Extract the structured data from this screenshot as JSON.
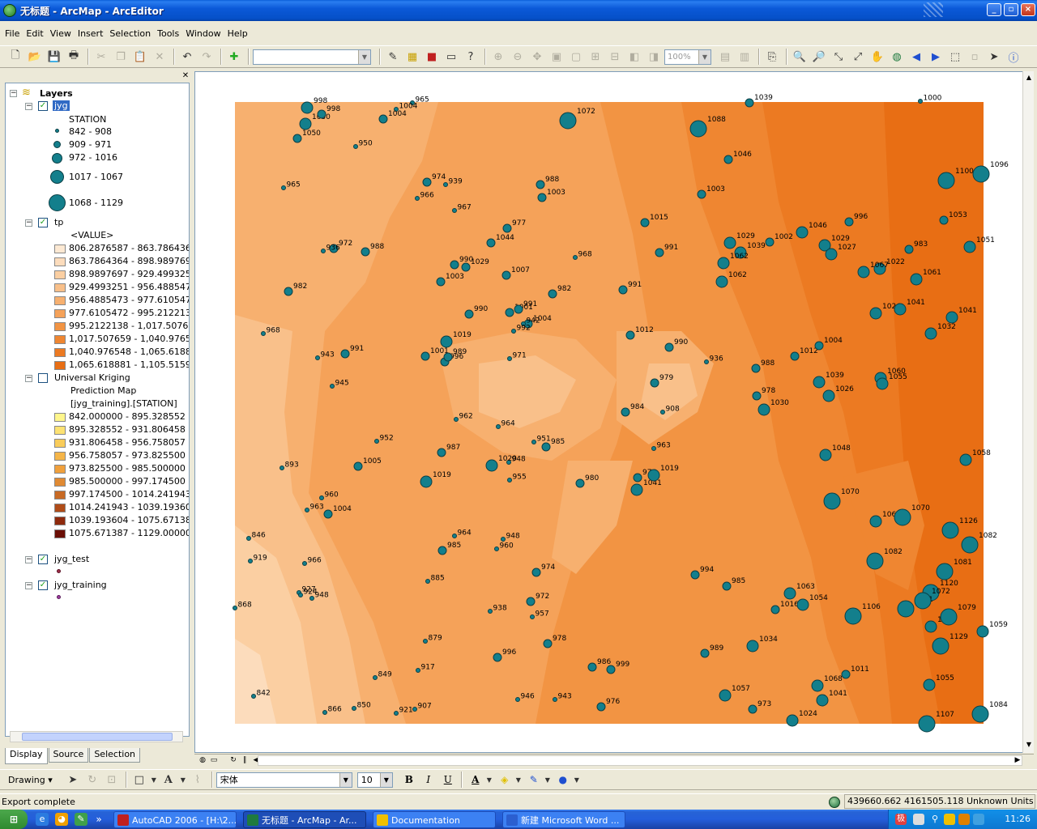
{
  "window": {
    "title": "无标题 - ArcMap - ArcEditor"
  },
  "menu": [
    "File",
    "Edit",
    "View",
    "Insert",
    "Selection",
    "Tools",
    "Window",
    "Help"
  ],
  "toolbar": {
    "scale_value": "",
    "zoom_value": "100%"
  },
  "toc": {
    "root_label": "Layers",
    "jyg": {
      "label": "jyg",
      "field": "STATION",
      "classes": [
        "842 - 908",
        "909 - 971",
        "972 - 1016",
        "1017 - 1067",
        "1068 - 1129"
      ]
    },
    "tp": {
      "label": "tp",
      "field": "<VALUE>",
      "classes": [
        {
          "label": "806.2876587 - 863.7864363",
          "color": "#fde9d3"
        },
        {
          "label": "863.7864364 - 898.9897696",
          "color": "#fcdcbc"
        },
        {
          "label": "898.9897697 - 929.499325",
          "color": "#fbcfa2"
        },
        {
          "label": "929.4993251 - 956.4885472",
          "color": "#f9c08a"
        },
        {
          "label": "956.4885473 - 977.6105471",
          "color": "#f7b06f"
        },
        {
          "label": "977.6105472 - 995.2122137",
          "color": "#f5a259"
        },
        {
          "label": "995.2122138 - 1,017.507658",
          "color": "#f29443"
        },
        {
          "label": "1,017.507659 - 1,040.97654",
          "color": "#ef8631"
        },
        {
          "label": "1,040.976548 - 1,065.61888",
          "color": "#ec7a22"
        },
        {
          "label": "1,065.618881 - 1,105.51599",
          "color": "#e86e14"
        }
      ]
    },
    "kriging": {
      "label": "Universal Kriging",
      "sub1": "Prediction Map",
      "sub2": "[jyg_training].[STATION]",
      "classes": [
        {
          "label": "842.000000 - 895.328552",
          "color": "#fff68c"
        },
        {
          "label": "895.328552 - 931.806458",
          "color": "#fde273"
        },
        {
          "label": "931.806458 - 956.758057",
          "color": "#f9cc5a"
        },
        {
          "label": "956.758057 - 973.825500",
          "color": "#f5b548"
        },
        {
          "label": "973.825500 - 985.500000",
          "color": "#f0a03c"
        },
        {
          "label": "985.500000 - 997.174500",
          "color": "#e08a33"
        },
        {
          "label": "997.174500 - 1014.241943",
          "color": "#c86a24"
        },
        {
          "label": "1014.241943 - 1039.193604",
          "color": "#b04c18"
        },
        {
          "label": "1039.193604 - 1075.671387",
          "color": "#8f2a0d"
        },
        {
          "label": "1075.671387 - 1129.000000",
          "color": "#6b0f06"
        }
      ]
    },
    "jyg_test": {
      "label": "jyg_test"
    },
    "jyg_training": {
      "label": "jyg_training"
    },
    "tabs": [
      "Display",
      "Source",
      "Selection"
    ]
  },
  "map": {
    "stations": [
      [
        378,
        132,
        998,
        4
      ],
      [
        376,
        152,
        1050,
        4
      ],
      [
        508,
        126,
        965,
        2
      ],
      [
        488,
        134,
        1004,
        2
      ],
      [
        472,
        146,
        1004,
        3
      ],
      [
        396,
        140,
        998,
        3
      ],
      [
        366,
        170,
        1050,
        3
      ],
      [
        438,
        180,
        950,
        2
      ],
      [
        700,
        148,
        1072,
        5
      ],
      [
        924,
        126,
        1039,
        3
      ],
      [
        861,
        158,
        1088,
        5
      ],
      [
        1135,
        124,
        1000,
        2
      ],
      [
        898,
        196,
        1046,
        3
      ],
      [
        1167,
        222,
        1100,
        5
      ],
      [
        1210,
        214,
        1096,
        5
      ],
      [
        349,
        231,
        965,
        2
      ],
      [
        526,
        224,
        974,
        3
      ],
      [
        549,
        227,
        939,
        2
      ],
      [
        514,
        244,
        966,
        2
      ],
      [
        666,
        227,
        988,
        3
      ],
      [
        668,
        243,
        1003,
        3
      ],
      [
        560,
        259,
        967,
        2
      ],
      [
        865,
        239,
        1003,
        3
      ],
      [
        795,
        274,
        1015,
        3
      ],
      [
        625,
        281,
        977,
        3
      ],
      [
        605,
        299,
        1044,
        3
      ],
      [
        1164,
        271,
        1053,
        3
      ],
      [
        1047,
        273,
        996,
        3
      ],
      [
        989,
        286,
        1046,
        4
      ],
      [
        411,
        306,
        972,
        3
      ],
      [
        398,
        309,
        936,
        2
      ],
      [
        450,
        310,
        988,
        3
      ],
      [
        560,
        326,
        990,
        3
      ],
      [
        574,
        329,
        1029,
        3
      ],
      [
        624,
        339,
        1007,
        3
      ],
      [
        543,
        347,
        1003,
        3
      ],
      [
        709,
        317,
        968,
        2
      ],
      [
        813,
        311,
        991,
        3
      ],
      [
        900,
        299,
        1029,
        4
      ],
      [
        913,
        311,
        1039,
        4
      ],
      [
        949,
        298,
        1002,
        3
      ],
      [
        1017,
        302,
        1029,
        4
      ],
      [
        1025,
        313,
        1027,
        4
      ],
      [
        1196,
        304,
        1051,
        4
      ],
      [
        1121,
        307,
        983,
        3
      ],
      [
        1085,
        331,
        1022,
        4
      ],
      [
        1065,
        335,
        1067,
        4
      ],
      [
        892,
        324,
        1062,
        4
      ],
      [
        890,
        347,
        1062,
        4
      ],
      [
        1130,
        344,
        1061,
        4
      ],
      [
        355,
        359,
        982,
        3
      ],
      [
        681,
        362,
        982,
        3
      ],
      [
        768,
        357,
        991,
        3
      ],
      [
        1080,
        386,
        1024,
        4
      ],
      [
        1110,
        381,
        1041,
        4
      ],
      [
        578,
        387,
        990,
        3
      ],
      [
        628,
        385,
        1001,
        3
      ],
      [
        639,
        381,
        991,
        3
      ],
      [
        651,
        399,
        1004,
        3
      ],
      [
        645,
        399,
        942,
        2
      ],
      [
        633,
        408,
        992,
        2
      ],
      [
        1148,
        411,
        1032,
        4
      ],
      [
        1174,
        391,
        1041,
        4
      ],
      [
        324,
        411,
        968,
        2
      ],
      [
        550,
        421,
        1019,
        4
      ],
      [
        524,
        439,
        1001,
        3
      ],
      [
        548,
        446,
        996,
        3
      ],
      [
        552,
        440,
        989,
        3
      ],
      [
        628,
        442,
        971,
        2
      ],
      [
        425,
        436,
        991,
        3
      ],
      [
        391,
        441,
        943,
        2
      ],
      [
        777,
        413,
        1012,
        3
      ],
      [
        825,
        428,
        990,
        3
      ],
      [
        871,
        446,
        936,
        2
      ],
      [
        932,
        454,
        988,
        3
      ],
      [
        980,
        439,
        1012,
        3
      ],
      [
        1010,
        426,
        1004,
        3
      ],
      [
        1010,
        471,
        1039,
        4
      ],
      [
        1022,
        488,
        1026,
        4
      ],
      [
        1086,
        466,
        1060,
        4
      ],
      [
        1088,
        473,
        1055,
        4
      ],
      [
        409,
        476,
        945,
        2
      ],
      [
        807,
        472,
        979,
        3
      ],
      [
        933,
        488,
        978,
        3
      ],
      [
        942,
        505,
        1030,
        4
      ],
      [
        771,
        508,
        984,
        3
      ],
      [
        817,
        508,
        908,
        2
      ],
      [
        562,
        517,
        962,
        2
      ],
      [
        614,
        526,
        964,
        2
      ],
      [
        464,
        544,
        952,
        2
      ],
      [
        544,
        558,
        987,
        3
      ],
      [
        658,
        545,
        951,
        2
      ],
      [
        673,
        551,
        985,
        3
      ],
      [
        627,
        570,
        948,
        2
      ],
      [
        606,
        574,
        1020,
        4
      ],
      [
        441,
        575,
        1005,
        3
      ],
      [
        347,
        577,
        893,
        2
      ],
      [
        525,
        594,
        1019,
        4
      ],
      [
        628,
        592,
        955,
        2
      ],
      [
        715,
        596,
        980,
        3
      ],
      [
        806,
        553,
        963,
        2
      ],
      [
        786,
        589,
        976,
        3
      ],
      [
        785,
        604,
        1041,
        4
      ],
      [
        806,
        586,
        1019,
        4
      ],
      [
        1018,
        561,
        1048,
        4
      ],
      [
        1191,
        567,
        1058,
        4
      ],
      [
        396,
        614,
        960,
        2
      ],
      [
        378,
        629,
        963,
        2
      ],
      [
        404,
        634,
        1004,
        3
      ],
      [
        1026,
        618,
        1070,
        5
      ],
      [
        1080,
        643,
        1062,
        4
      ],
      [
        1113,
        638,
        1070,
        5
      ],
      [
        1172,
        654,
        1126,
        5
      ],
      [
        1196,
        672,
        1082,
        5
      ],
      [
        306,
        664,
        846,
        2
      ],
      [
        560,
        661,
        964,
        2
      ],
      [
        612,
        677,
        960,
        2
      ],
      [
        620,
        665,
        948,
        2
      ],
      [
        545,
        679,
        985,
        3
      ],
      [
        308,
        692,
        919,
        2
      ],
      [
        375,
        695,
        966,
        2
      ],
      [
        661,
        706,
        974,
        3
      ],
      [
        857,
        709,
        994,
        3
      ],
      [
        896,
        723,
        985,
        3
      ],
      [
        1079,
        692,
        1082,
        5
      ],
      [
        1165,
        705,
        1081,
        5
      ],
      [
        1148,
        731,
        1120,
        5
      ],
      [
        527,
        717,
        885,
        2
      ],
      [
        368,
        731,
        927,
        2
      ],
      [
        370,
        734,
        924,
        2
      ],
      [
        384,
        738,
        948,
        2
      ],
      [
        654,
        742,
        972,
        3
      ],
      [
        656,
        761,
        957,
        2
      ],
      [
        604,
        754,
        938,
        2
      ],
      [
        974,
        732,
        1063,
        4
      ],
      [
        956,
        752,
        1016,
        3
      ],
      [
        990,
        746,
        1054,
        4
      ],
      [
        1052,
        760,
        1106,
        5
      ],
      [
        1117,
        751,
        1121,
        5
      ],
      [
        1138,
        741,
        1072,
        5
      ],
      [
        1148,
        773,
        1063,
        4
      ],
      [
        1170,
        761,
        1079,
        5
      ],
      [
        1212,
        779,
        1059,
        4
      ],
      [
        289,
        750,
        868,
        2
      ],
      [
        524,
        791,
        879,
        2
      ],
      [
        675,
        794,
        978,
        3
      ],
      [
        869,
        806,
        989,
        3
      ],
      [
        928,
        797,
        1034,
        4
      ],
      [
        1160,
        797,
        1129,
        5
      ],
      [
        613,
        811,
        996,
        3
      ],
      [
        730,
        823,
        986,
        3
      ],
      [
        753,
        826,
        999,
        3
      ],
      [
        515,
        827,
        917,
        2
      ],
      [
        462,
        836,
        849,
        2
      ],
      [
        1043,
        832,
        1011,
        3
      ],
      [
        1008,
        846,
        1068,
        4
      ],
      [
        1014,
        864,
        1041,
        4
      ],
      [
        1146,
        845,
        1055,
        4
      ],
      [
        312,
        859,
        842,
        2
      ],
      [
        894,
        858,
        1057,
        4
      ],
      [
        638,
        863,
        946,
        2
      ],
      [
        684,
        863,
        943,
        2
      ],
      [
        741,
        872,
        976,
        3
      ],
      [
        928,
        875,
        973,
        3
      ],
      [
        400,
        879,
        866,
        2
      ],
      [
        436,
        874,
        850,
        2
      ],
      [
        488,
        880,
        921,
        2
      ],
      [
        511,
        875,
        907,
        2
      ],
      [
        977,
        889,
        1024,
        4
      ],
      [
        1143,
        893,
        1107,
        5
      ],
      [
        1209,
        881,
        1084,
        5
      ]
    ]
  },
  "drawing_toolbar": {
    "drawing_label": "Drawing",
    "font_name": "宋体",
    "font_size": "10"
  },
  "status": {
    "message": "Export complete",
    "coords": "439660.662  4161505.118 Unknown Units"
  },
  "taskbar": {
    "tasks": [
      {
        "label": "AutoCAD 2006 - [H:\\2...",
        "active": false
      },
      {
        "label": "无标题 - ArcMap - Ar...",
        "active": true
      },
      {
        "label": "Documentation",
        "active": false
      },
      {
        "label": "新建 Microsoft Word ...",
        "active": false
      }
    ],
    "tray_ime": "极",
    "clock": "11:26"
  }
}
